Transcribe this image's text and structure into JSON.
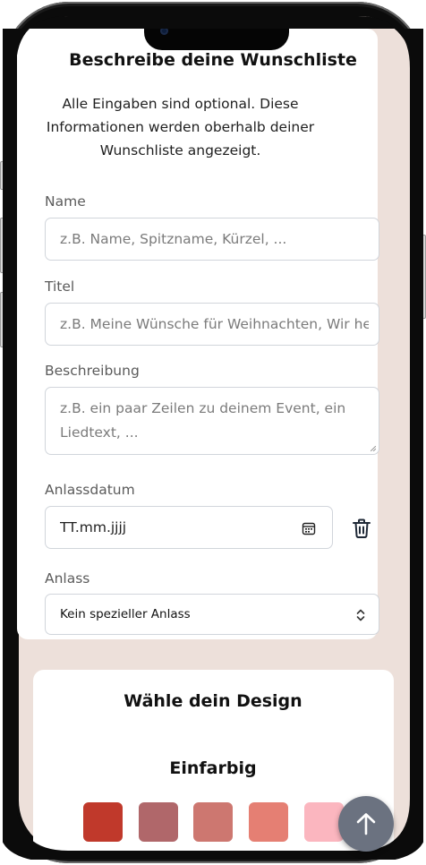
{
  "details": {
    "title": "Beschreibe deine Wunschliste",
    "subtitle": "Alle Eingaben sind optional. Diese Informationen werden oberhalb deiner Wunschliste angezeigt.",
    "name_label": "Name",
    "name_placeholder": "z.B. Name, Spitzname, Kürzel, ...",
    "title_label": "Titel",
    "title_placeholder": "z.B. Meine Wünsche für Weihnachten, Wir he",
    "description_label": "Beschreibung",
    "description_placeholder": "z.B. ein paar Zeilen zu deinem Event, ein Liedtext, ...",
    "date_label": "Anlassdatum",
    "date_placeholder": "TT.mm.jjjj",
    "occasion_label": "Anlass",
    "occasion_value": "Kein spezieller Anlass"
  },
  "design": {
    "title": "Wähle dein Design",
    "solid_title": "Einfarbig",
    "swatches": [
      "#c0392b",
      "#b0676a",
      "#cd7770",
      "#e57f73",
      "#fbb6bf"
    ]
  },
  "icons": {
    "date_picker": "calendar-icon",
    "delete": "trash-icon",
    "select": "chevron-up-down-icon",
    "scroll_top": "arrow-up-icon"
  },
  "colors": {
    "screen_bg": "#ede0da",
    "card_bg": "#ffffff",
    "fab_bg": "#6b7280"
  }
}
